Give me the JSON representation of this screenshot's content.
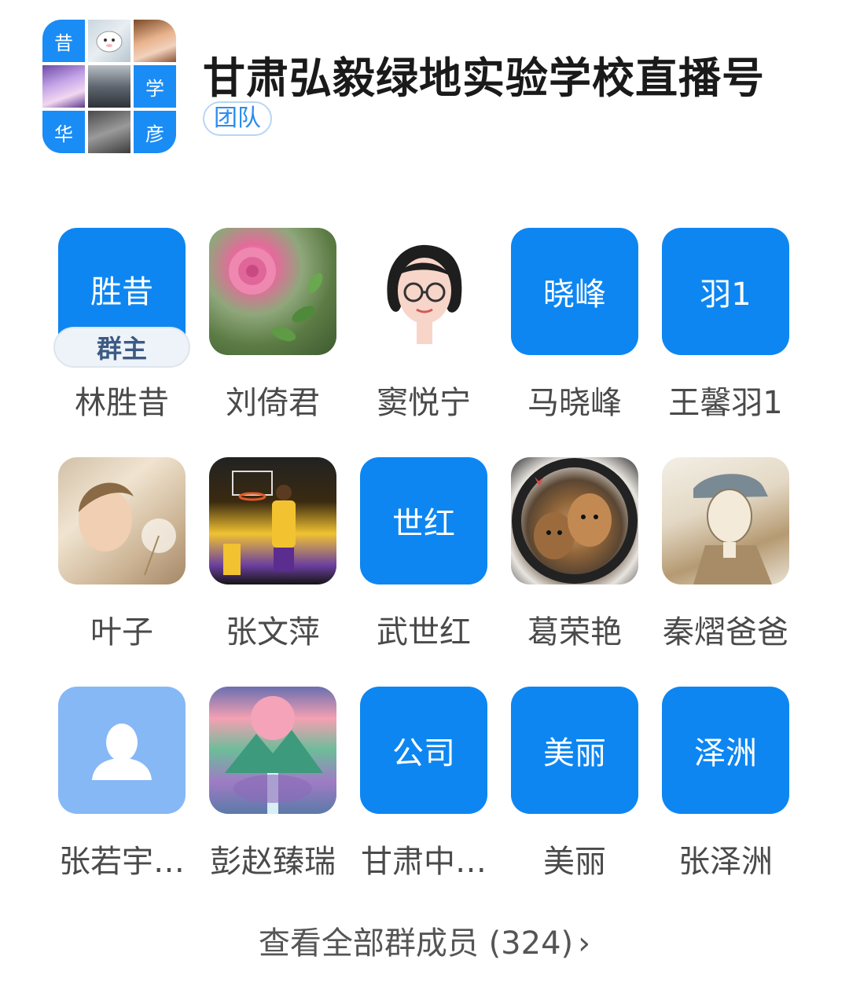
{
  "group": {
    "title": "甘肃弘毅绿地实验学校直播号",
    "tag": "团队",
    "avatar_tiles": [
      {
        "text": "昔",
        "kind": "blue"
      },
      {
        "text": "",
        "kind": "img1"
      },
      {
        "text": "",
        "kind": "img2"
      },
      {
        "text": "",
        "kind": "img3"
      },
      {
        "text": "",
        "kind": "img4"
      },
      {
        "text": "学",
        "kind": "blue"
      },
      {
        "text": "华",
        "kind": "blue"
      },
      {
        "text": "",
        "kind": "img5"
      },
      {
        "text": "彦",
        "kind": "blue"
      }
    ]
  },
  "members": [
    {
      "name": "林胜昔",
      "avatar_text": "胜昔",
      "badge": "群主"
    },
    {
      "name": "刘倚君",
      "avatar_text": ""
    },
    {
      "name": "窦悦宁",
      "avatar_text": ""
    },
    {
      "name": "马晓峰",
      "avatar_text": "晓峰"
    },
    {
      "name": "王馨羽1",
      "avatar_text": "羽1"
    },
    {
      "name": "叶子",
      "avatar_text": ""
    },
    {
      "name": "张文萍",
      "avatar_text": ""
    },
    {
      "name": "武世红",
      "avatar_text": "世红"
    },
    {
      "name": "葛荣艳",
      "avatar_text": ""
    },
    {
      "name": "秦熠爸爸",
      "avatar_text": ""
    },
    {
      "name": "张若宇…",
      "avatar_text": ""
    },
    {
      "name": "彭赵臻瑞",
      "avatar_text": ""
    },
    {
      "name": "甘肃中…",
      "avatar_text": "公司"
    },
    {
      "name": "美丽",
      "avatar_text": "美丽"
    },
    {
      "name": "张泽洲",
      "avatar_text": "泽洲"
    }
  ],
  "footer": {
    "view_all": "查看全部群成员 (324)",
    "chevron": "›"
  },
  "colors": {
    "accent_blue": "#0d86f2",
    "placeholder_blue": "#86b8f6"
  }
}
